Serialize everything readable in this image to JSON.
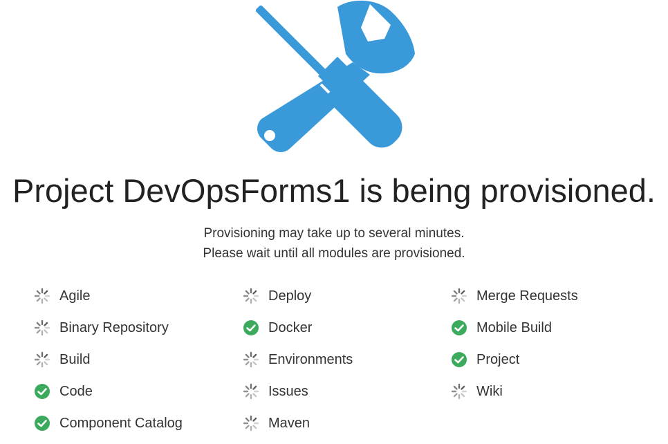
{
  "header": {
    "icon": "tools-icon",
    "icon_color": "#3A9AD9",
    "title": "Project DevOpsForms1 is being provisioned.",
    "subtitle_lines": [
      "Provisioning may take up to several minutes.",
      "Please wait until all modules are provisioned."
    ]
  },
  "status_colors": {
    "done": "#3BAA5C",
    "pending": "#555555"
  },
  "modules": {
    "columns": [
      [
        {
          "label": "Agile",
          "status": "pending"
        },
        {
          "label": "Binary Repository",
          "status": "pending"
        },
        {
          "label": "Build",
          "status": "pending"
        },
        {
          "label": "Code",
          "status": "done"
        },
        {
          "label": "Component Catalog",
          "status": "done"
        }
      ],
      [
        {
          "label": "Deploy",
          "status": "pending"
        },
        {
          "label": "Docker",
          "status": "done"
        },
        {
          "label": "Environments",
          "status": "pending"
        },
        {
          "label": "Issues",
          "status": "pending"
        },
        {
          "label": "Maven",
          "status": "pending"
        }
      ],
      [
        {
          "label": "Merge Requests",
          "status": "pending"
        },
        {
          "label": "Mobile Build",
          "status": "done"
        },
        {
          "label": "Project",
          "status": "done"
        },
        {
          "label": "Wiki",
          "status": "pending"
        }
      ]
    ]
  }
}
